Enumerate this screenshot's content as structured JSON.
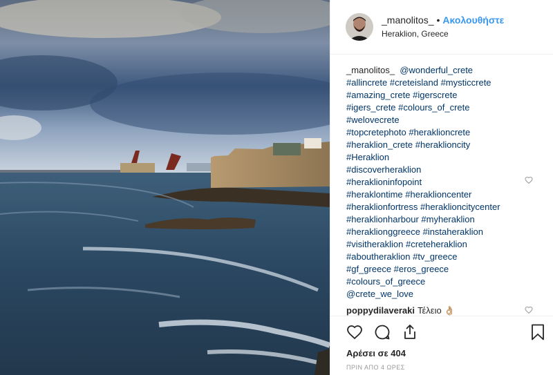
{
  "header": {
    "username": "_manolitos_",
    "separator": "•",
    "follow_label": "Ακολουθήστε",
    "location": "Heraklion, Greece"
  },
  "caption": {
    "author": "_manolitos_",
    "lines": [
      "@wonderful_crete",
      "#allincrete #creteisland #mysticcrete",
      "#amazing_crete #igerscrete",
      "#igers_crete #colours_of_crete",
      "#welovecrete",
      "#topcretephoto #heraklioncrete",
      "#heraklion_crete #heraklioncity",
      "#Heraklion",
      "#discoverheraklion",
      "#heraklioninfopoint",
      "#heraklontime #heraklioncenter",
      "#heraklionfortress #heraklioncitycenter",
      "#heraklionharbour #myheraklion",
      "#heraklionggreece #instaheraklion",
      "#visitheraklion #creteheraklion",
      "#aboutheraklion #tv_greece",
      "#gf_greece #eros_greece",
      "#colours_of_greece",
      "@crete_we_love"
    ]
  },
  "comment": {
    "username": "poppydilaveraki",
    "text": "Τέλειο 👌🏼"
  },
  "likes_label": "Αρέσει σε 404",
  "time_label": "ΠΡΙΝ ΑΠΟ 4 ΩΡΕΣ",
  "icons": {
    "like": "heart-icon",
    "comment": "comment-icon",
    "share": "share-icon",
    "save": "bookmark-icon",
    "caption_like": "heart-icon",
    "comment_like": "heart-icon"
  },
  "colors": {
    "follow": "#3897f0",
    "hashtag": "#003569",
    "text": "#262626",
    "muted": "#999999"
  }
}
